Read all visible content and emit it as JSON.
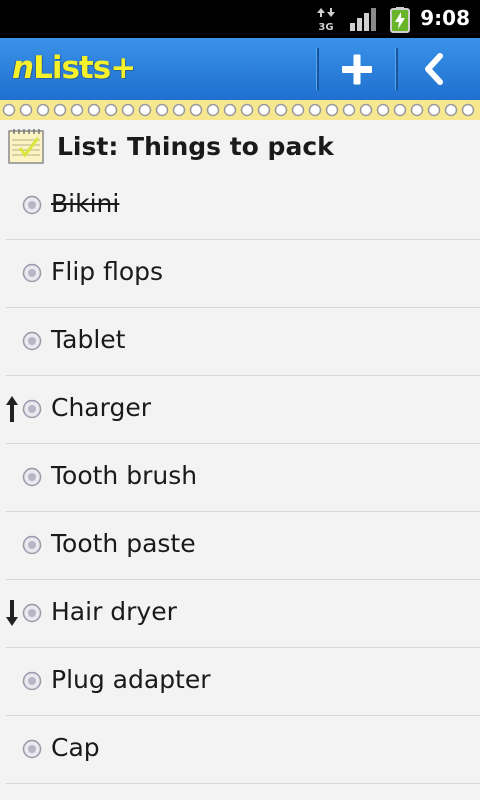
{
  "status_bar": {
    "network": "3G",
    "time": "9:08"
  },
  "app_bar": {
    "logo_prefix": "n",
    "logo_main": "Lists",
    "logo_plus": "+",
    "add_icon": "plus-icon",
    "back_icon": "chevron-left-icon"
  },
  "list": {
    "title": "List: Things to pack",
    "items": [
      {
        "label": "Bikini",
        "done": true,
        "arrow": null
      },
      {
        "label": "Flip flops",
        "done": false,
        "arrow": null
      },
      {
        "label": "Tablet",
        "done": false,
        "arrow": null
      },
      {
        "label": "Charger",
        "done": false,
        "arrow": "up"
      },
      {
        "label": "Tooth brush",
        "done": false,
        "arrow": null
      },
      {
        "label": "Tooth paste",
        "done": false,
        "arrow": null
      },
      {
        "label": "Hair dryer",
        "done": false,
        "arrow": "down"
      },
      {
        "label": "Plug adapter",
        "done": false,
        "arrow": null
      },
      {
        "label": "Cap",
        "done": false,
        "arrow": null
      }
    ]
  },
  "colors": {
    "app_bar": "#2a80dc",
    "logo": "#f5f12a",
    "ribbon": "#f7e890",
    "background": "#f3f3f3"
  }
}
